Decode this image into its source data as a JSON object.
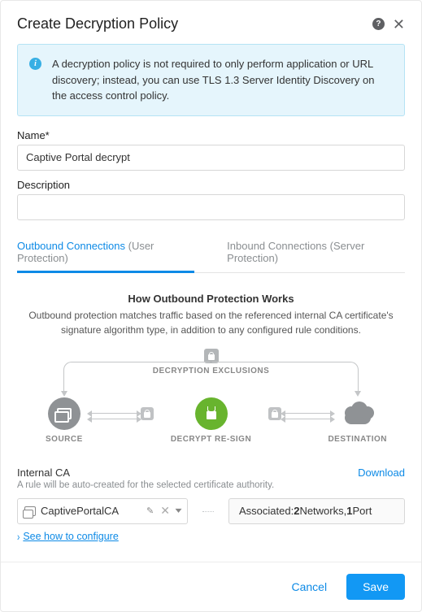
{
  "header": {
    "title": "Create Decryption Policy"
  },
  "info": {
    "text": "A decryption policy is not required to only perform application or URL discovery; instead, you can use TLS 1.3 Server Identity Discovery on the access control policy."
  },
  "name": {
    "label": "Name*",
    "value": "Captive Portal decrypt"
  },
  "description": {
    "label": "Description",
    "value": ""
  },
  "tabs": {
    "outbound": {
      "label": "Outbound Connections",
      "hint": "(User Protection)"
    },
    "inbound": {
      "label": "Inbound Connections",
      "hint": "(Server Protection)"
    }
  },
  "diagram": {
    "title": "How Outbound Protection Works",
    "subtitle": "Outbound protection matches traffic based on the referenced internal CA certificate's signature algorithm type, in addition to any configured rule conditions.",
    "exclusions": "DECRYPTION EXCLUSIONS",
    "source": "SOURCE",
    "mid": "DECRYPT RE-SIGN",
    "destination": "DESTINATION"
  },
  "ca": {
    "label": "Internal CA",
    "hint": "A rule will be auto-created for the selected certificate authority.",
    "download": "Download",
    "value": "CaptivePortalCA",
    "assoc_prefix": "Associated: ",
    "assoc_net_count": "2",
    "assoc_net_label": " Networks, ",
    "assoc_port_count": "1",
    "assoc_port_label": " Port",
    "howto": "See how to configure"
  },
  "footer": {
    "cancel": "Cancel",
    "save": "Save"
  }
}
